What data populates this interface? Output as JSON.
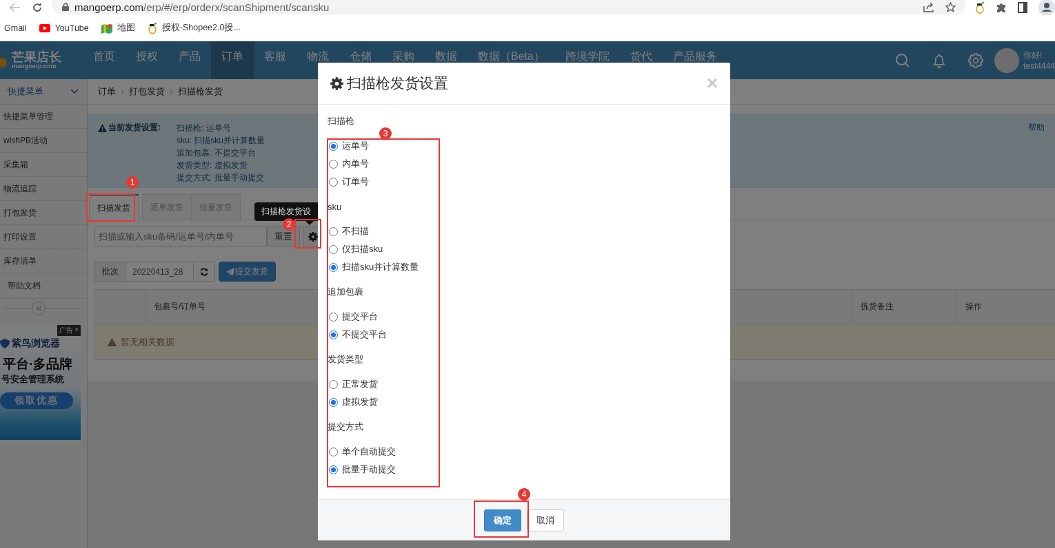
{
  "browser": {
    "url_host": "mangoerp.com",
    "url_path": "/erp/#/erp/orderx/scanShipment/scansku"
  },
  "bookmarks": [
    {
      "label": "Gmail",
      "kind": "plain"
    },
    {
      "label": "YouTube",
      "kind": "video"
    },
    {
      "label": "地图",
      "kind": "map"
    },
    {
      "label": "授权-Shopee2.0授...",
      "kind": "fruit"
    }
  ],
  "app": {
    "logo": "芒果店长",
    "logo_sub": "mangoerp.com",
    "greeting": "你好!",
    "username": "test4444",
    "nav": [
      {
        "label": "首页",
        "selected": false
      },
      {
        "label": "授权",
        "selected": false
      },
      {
        "label": "产品",
        "selected": false
      },
      {
        "label": "订单",
        "selected": true
      },
      {
        "label": "客服",
        "selected": false
      },
      {
        "label": "物流",
        "selected": false
      },
      {
        "label": "仓储",
        "selected": false
      },
      {
        "label": "采购",
        "selected": false
      },
      {
        "label": "数据",
        "selected": false
      },
      {
        "label": "数据（Beta）",
        "selected": false
      },
      {
        "label": "跨境学院",
        "selected": false
      },
      {
        "label": "货代",
        "selected": false
      },
      {
        "label": "产品服务",
        "selected": false
      }
    ]
  },
  "sidebar": {
    "title": "快捷菜单",
    "items": [
      "快捷菜单管理",
      "wishPB活动",
      "采集箱",
      "物流追踪",
      "打包发货",
      "打印设置",
      "库存清单"
    ],
    "help": "帮助文档",
    "ad": {
      "tag": "广告",
      "close": "×",
      "brand": "紫鸟浏览器",
      "headline": "平台·多品牌",
      "subline": "号安全管理系统",
      "cta": "领取优惠"
    }
  },
  "breadcrumb": [
    "订单",
    "打包发货",
    "扫描枪发货"
  ],
  "settings_alert": {
    "title": "当前发货设置:",
    "lines": [
      "扫描枪: 运单号",
      "sku: 扫描sku并计算数量",
      "追加包裹: 不提交平台",
      "发货类型: 虚拟发货",
      "提交方式: 批量手动提交"
    ],
    "help": "帮助"
  },
  "tabs": [
    {
      "label": "扫描发货",
      "selected": true
    },
    {
      "label": "逐单发货",
      "selected": false
    },
    {
      "label": "批量发货",
      "selected": false
    }
  ],
  "scan": {
    "placeholder": "扫描或输入sku条码/运单号/内单号",
    "reset": "重置"
  },
  "tooltip": "扫描枪发货设",
  "batch": {
    "label": "批次",
    "value": "20220413_28",
    "submit": "提交发货"
  },
  "table": {
    "columns": [
      "包裹号/订单号",
      "拣货备注",
      "操作"
    ],
    "empty": "暂无相关数据"
  },
  "modal": {
    "title": "扫描枪发货设置",
    "close": "×",
    "groups": [
      {
        "label": "扫描枪",
        "options": [
          {
            "label": "运单号",
            "selected": true
          },
          {
            "label": "内单号",
            "selected": false
          },
          {
            "label": "订单号",
            "selected": false
          }
        ]
      },
      {
        "label": "sku",
        "options": [
          {
            "label": "不扫描",
            "selected": false
          },
          {
            "label": "仅扫描sku",
            "selected": false
          },
          {
            "label": "扫描sku并计算数量",
            "selected": true
          }
        ]
      },
      {
        "label": "追加包裹",
        "options": [
          {
            "label": "提交平台",
            "selected": false
          },
          {
            "label": "不提交平台",
            "selected": true
          }
        ]
      },
      {
        "label": "发货类型",
        "options": [
          {
            "label": "正常发货",
            "selected": false
          },
          {
            "label": "虚拟发货",
            "selected": true
          }
        ]
      },
      {
        "label": "提交方式",
        "options": [
          {
            "label": "单个自动提交",
            "selected": false
          },
          {
            "label": "批量手动提交",
            "selected": true
          }
        ]
      }
    ],
    "buttons": [
      {
        "label": "确定",
        "kind": "primary"
      },
      {
        "label": "取消",
        "kind": "default"
      }
    ]
  },
  "annotations": [
    {
      "number": "1"
    },
    {
      "number": "2"
    },
    {
      "number": "3"
    },
    {
      "number": "4"
    }
  ]
}
